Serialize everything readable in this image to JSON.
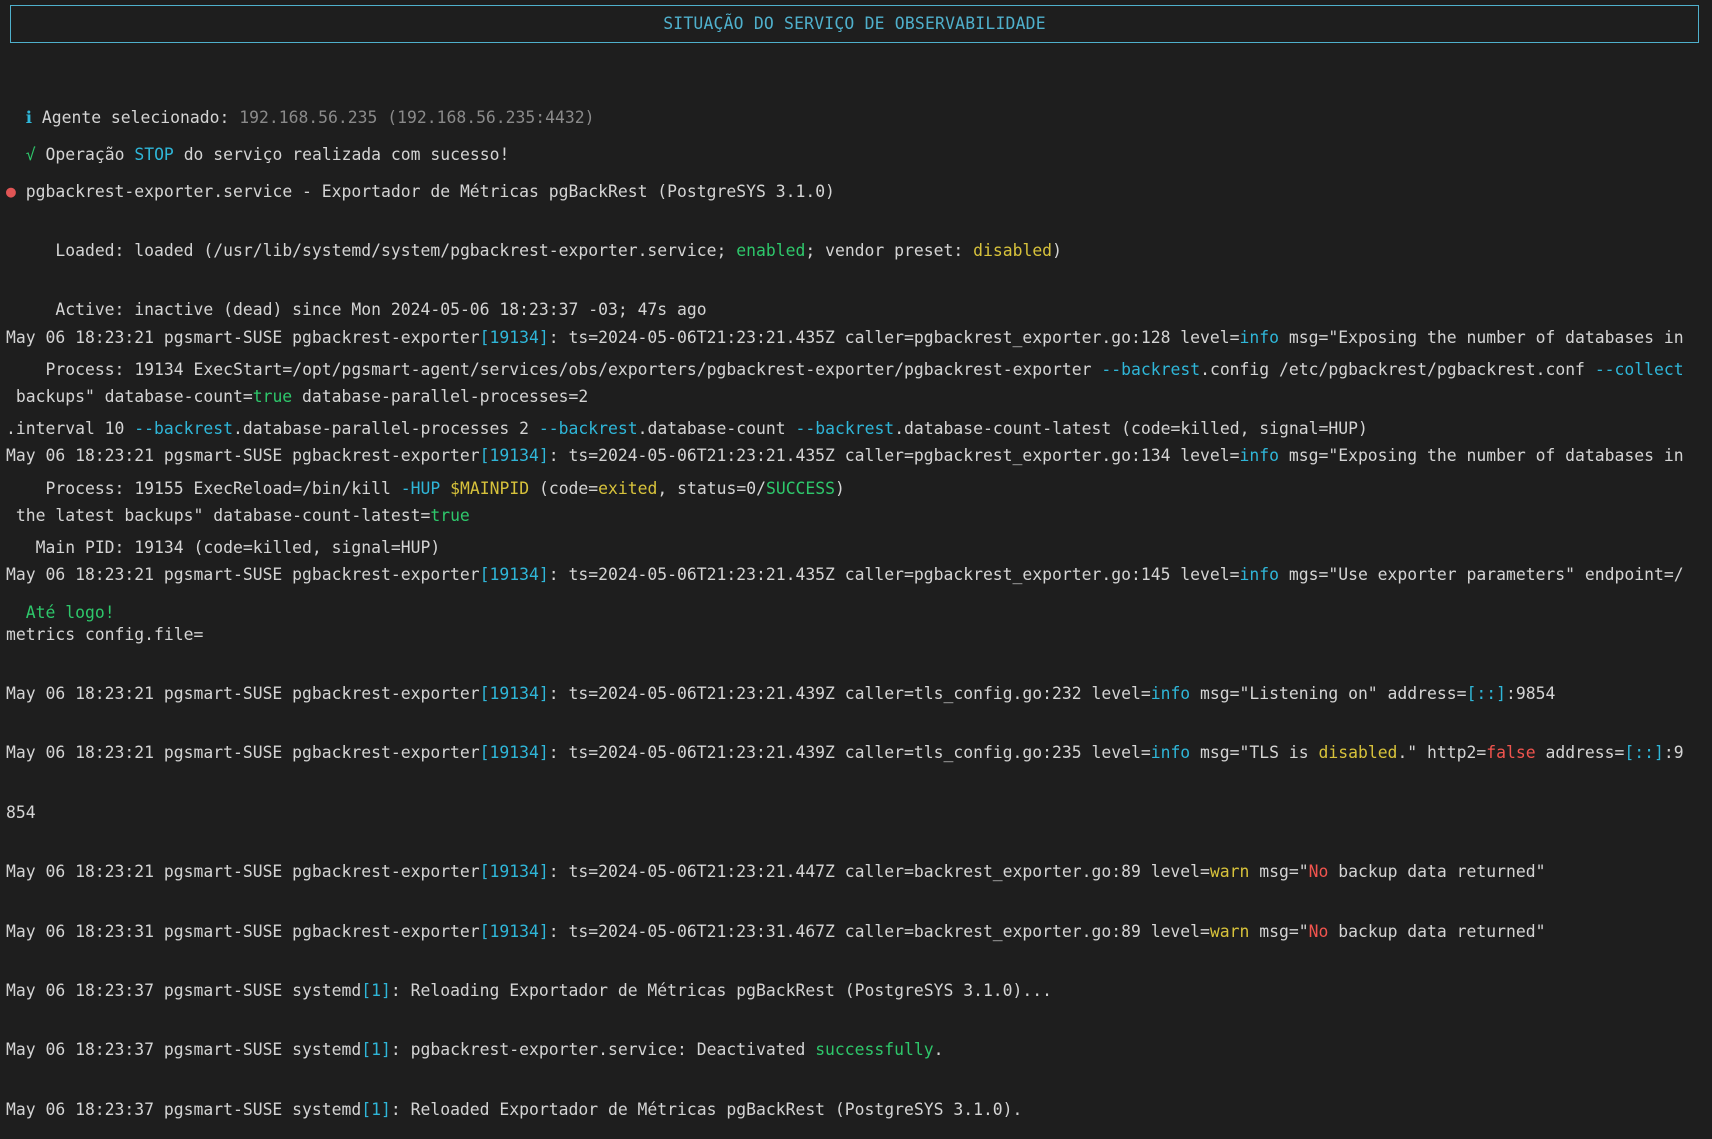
{
  "header": {
    "title": "SITUAÇÃO DO SERVIÇO DE OBSERVABILIDADE"
  },
  "agent": {
    "icon": "ℹ",
    "label": "Agente selecionado:",
    "value": "192.168.56.235 (192.168.56.235:4432)"
  },
  "operation": {
    "icon": "√",
    "prefix": "Operação",
    "op": "STOP",
    "suffix": "do serviço realizada com sucesso!"
  },
  "status": {
    "dot": "●",
    "title": "pgbackrest-exporter.service - Exportador de Métricas pgBackRest (PostgreSYS 3.1.0)",
    "loaded_key": "Loaded:",
    "loaded_a": "loaded (/usr/lib/systemd/system/pgbackrest-exporter.service;",
    "loaded_enabled": "enabled",
    "loaded_b": "; vendor preset:",
    "loaded_disabled": "disabled",
    "loaded_c": ")",
    "active_key": "Active:",
    "active_value": "inactive (dead) since Mon 2024-05-06 18:23:37 -03; 47s ago",
    "process1_key": "Process:",
    "process1_a": "19134 ExecStart=/opt/pgsmart-agent/services/obs/exporters/pgbackrest-exporter/pgbackrest-exporter",
    "process1_f1": "--backrest",
    "process1_b": ".config /etc/pgbackrest/pgbackrest.conf",
    "process1_f2": "--collect",
    "process1_c": ".interval 10",
    "process1_f3": "--backrest",
    "process1_d": ".database-parallel-processes 2",
    "process1_f4": "--backrest",
    "process1_e": ".database-count",
    "process1_f5": "--backrest",
    "process1_g": ".database-count-latest (code=killed, signal=HUP)",
    "process2_key": "Process:",
    "process2_a": "19155 ExecReload=/bin/kill",
    "process2_hup": "-HUP",
    "process2_var": "$MAINPID",
    "process2_b": "(code=",
    "process2_exited": "exited",
    "process2_c": ", status=0/",
    "process2_success": "SUCCESS",
    "process2_d": ")",
    "mainpid_key": "Main PID:",
    "mainpid_value": "19134 (code=killed, signal=HUP)"
  },
  "logs": {
    "l1_a": "May 06 18:23:21 pgsmart-SUSE pgbackrest-exporter",
    "l1_pid": "[19134]",
    "l1_b": ": ts=2024-05-06T21:23:21.435Z caller=pgbackrest_exporter.go:128 level=",
    "l1_lvl": "info",
    "l1_c": " msg=\"Exposing the number of databases in",
    "l1_d": " backups\" database-count=",
    "l1_true": "true",
    "l1_e": " database-parallel-processes=2",
    "l2_a": "May 06 18:23:21 pgsmart-SUSE pgbackrest-exporter",
    "l2_pid": "[19134]",
    "l2_b": ": ts=2024-05-06T21:23:21.435Z caller=pgbackrest_exporter.go:134 level=",
    "l2_lvl": "info",
    "l2_c": " msg=\"Exposing the number of databases in",
    "l2_d": " the latest backups\" database-count-latest=",
    "l2_true": "true",
    "l3_a": "May 06 18:23:21 pgsmart-SUSE pgbackrest-exporter",
    "l3_pid": "[19134]",
    "l3_b": ": ts=2024-05-06T21:23:21.435Z caller=pgbackrest_exporter.go:145 level=",
    "l3_lvl": "info",
    "l3_c": " mgs=\"Use exporter parameters\" endpoint=/",
    "l3_d": "metrics config.file=",
    "l4_a": "May 06 18:23:21 pgsmart-SUSE pgbackrest-exporter",
    "l4_pid": "[19134]",
    "l4_b": ": ts=2024-05-06T21:23:21.439Z caller=tls_config.go:232 level=",
    "l4_lvl": "info",
    "l4_c": " msg=\"Listening on\" address=",
    "l4_addr": "[::]",
    "l4_d": ":9854",
    "l5_a": "May 06 18:23:21 pgsmart-SUSE pgbackrest-exporter",
    "l5_pid": "[19134]",
    "l5_b": ": ts=2024-05-06T21:23:21.439Z caller=tls_config.go:235 level=",
    "l5_lvl": "info",
    "l5_c": " msg=\"TLS is ",
    "l5_disabled": "disabled",
    "l5_d": ".\" http2=",
    "l5_false": "false",
    "l5_e": " address=",
    "l5_addr": "[::]",
    "l5_f": ":9",
    "l5_g": "854",
    "l6_a": "May 06 18:23:21 pgsmart-SUSE pgbackrest-exporter",
    "l6_pid": "[19134]",
    "l6_b": ": ts=2024-05-06T21:23:21.447Z caller=backrest_exporter.go:89 level=",
    "l6_lvl": "warn",
    "l6_c": " msg=\"",
    "l6_no": "No",
    "l6_d": " backup data returned\"",
    "l7_a": "May 06 18:23:31 pgsmart-SUSE pgbackrest-exporter",
    "l7_pid": "[19134]",
    "l7_b": ": ts=2024-05-06T21:23:31.467Z caller=backrest_exporter.go:89 level=",
    "l7_lvl": "warn",
    "l7_c": " msg=\"",
    "l7_no": "No",
    "l7_d": " backup data returned\"",
    "l8_a": "May 06 18:23:37 pgsmart-SUSE systemd",
    "l8_pid": "[1]",
    "l8_b": ": Reloading Exportador de Métricas pgBackRest (PostgreSYS 3.1.0)...",
    "l9_a": "May 06 18:23:37 pgsmart-SUSE systemd",
    "l9_pid": "[1]",
    "l9_b": ": pgbackrest-exporter.service: Deactivated ",
    "l9_ok": "successfully",
    "l9_c": ".",
    "l10_a": "May 06 18:23:37 pgsmart-SUSE systemd",
    "l10_pid": "[1]",
    "l10_b": ": Reloaded Exportador de Métricas pgBackRest (PostgreSYS 3.1.0)."
  },
  "footer": {
    "goodbye": "Até logo!"
  }
}
